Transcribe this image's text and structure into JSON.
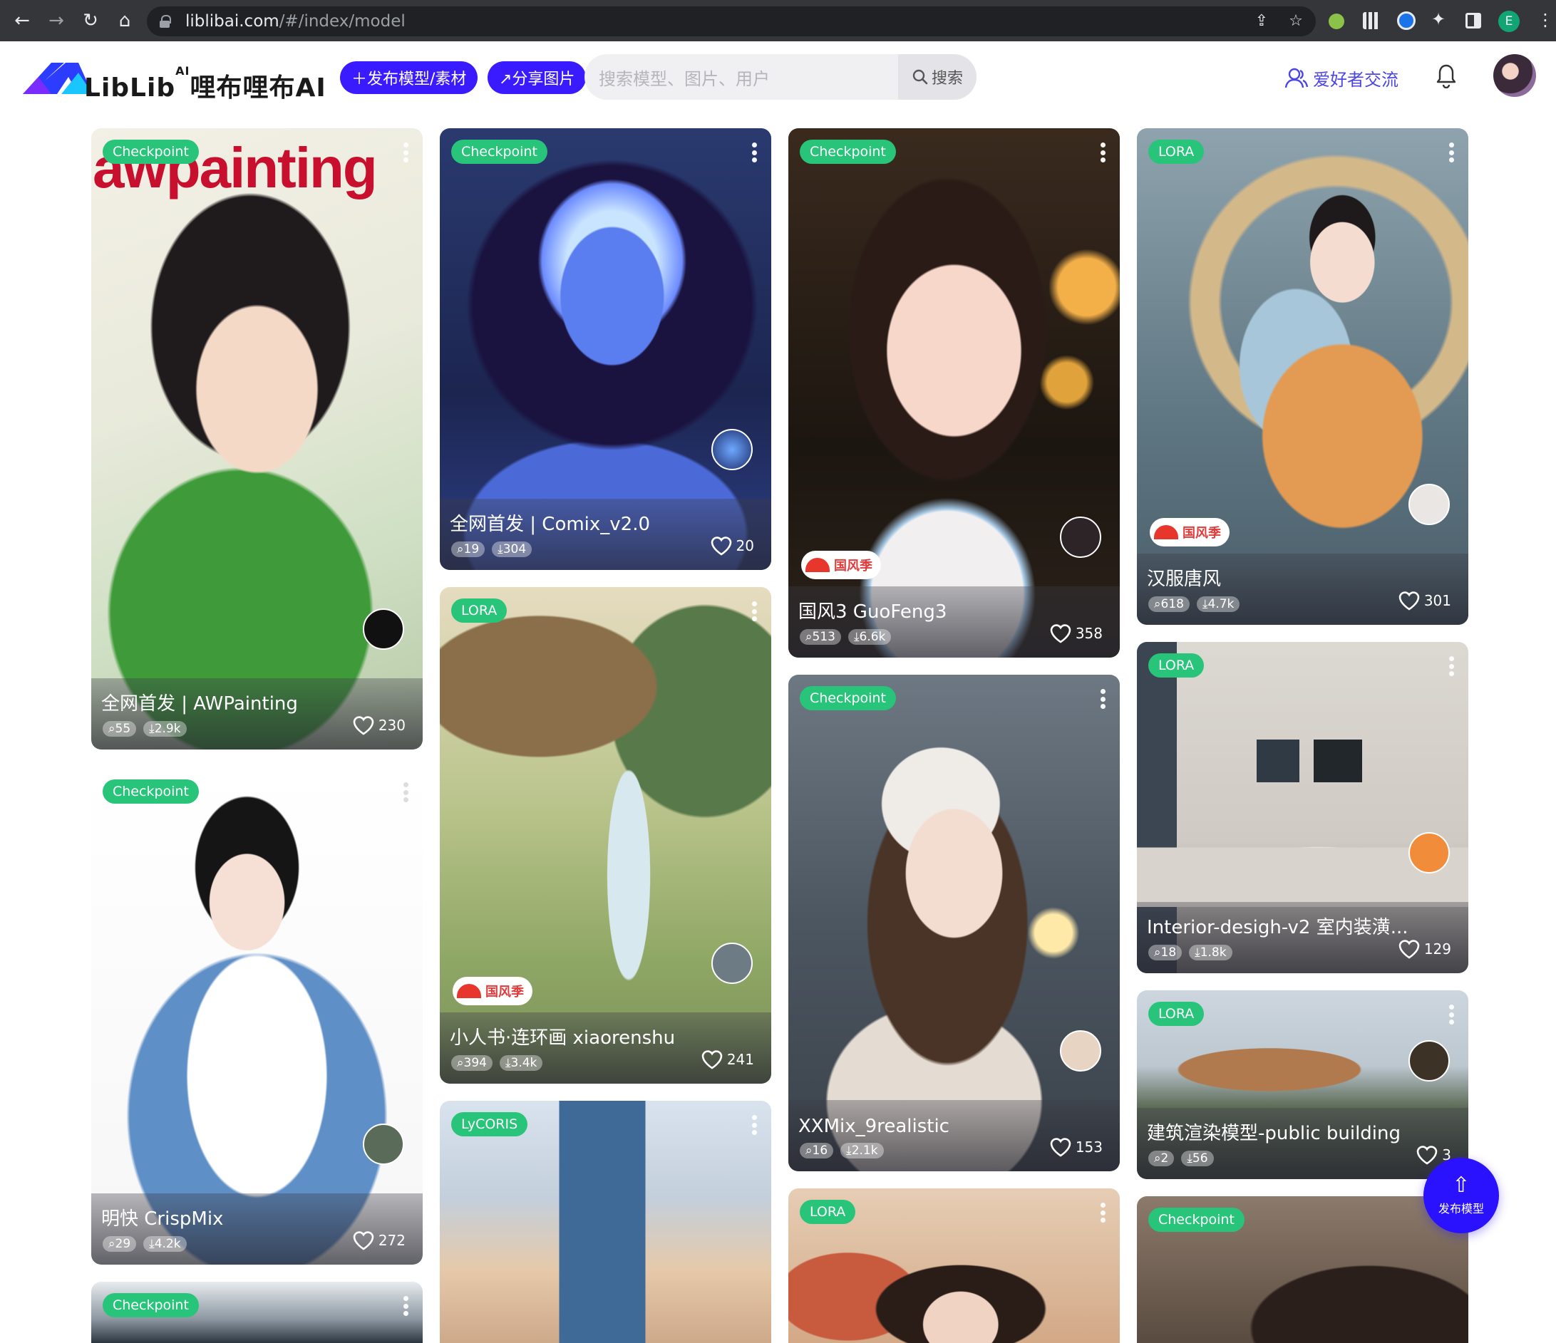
{
  "browser": {
    "url_host": "liblibai.com",
    "url_path": "/#/index/model",
    "profile_initial": "E"
  },
  "header": {
    "logo_text": "LibLib",
    "logo_sup": "AI",
    "logo_cn": "哩布哩布AI",
    "publish_button": "＋发布模型/素材",
    "share_button": "↗分享图片",
    "search_placeholder": "搜索模型、图片、用户",
    "search_button": "搜索",
    "community_link": "爱好者交流"
  },
  "cards": [
    {
      "badge": "Checkpoint",
      "title": "全网首发 | AWPainting",
      "comments": "55",
      "downloads": "2.9k",
      "likes": "230",
      "banner": "awpainting"
    },
    {
      "badge": "Checkpoint",
      "title": "全网首发 | Comix_v2.0",
      "comments": "19",
      "downloads": "304",
      "likes": "20"
    },
    {
      "badge": "Checkpoint",
      "title": "国风3 GuoFeng3",
      "comments": "513",
      "downloads": "6.6k",
      "likes": "358",
      "tag": "国风季"
    },
    {
      "badge": "LORA",
      "title": "汉服唐风",
      "comments": "618",
      "downloads": "4.7k",
      "likes": "301",
      "tag": "国风季"
    },
    {
      "badge": "Checkpoint",
      "title": "明快 CrispMix",
      "comments": "29",
      "downloads": "4.2k",
      "likes": "272"
    },
    {
      "badge": "LORA",
      "title": "小人书·连环画 xiaorenshu",
      "comments": "394",
      "downloads": "3.4k",
      "likes": "241",
      "tag": "国风季"
    },
    {
      "badge": "Checkpoint",
      "title": "XXMix_9realistic",
      "comments": "16",
      "downloads": "2.1k",
      "likes": "153"
    },
    {
      "badge": "LORA",
      "title": "Interior-desigh-v2 室内装潢...",
      "comments": "18",
      "downloads": "1.8k",
      "likes": "129"
    },
    {
      "badge": "LORA",
      "title": "建筑渲染模型-public building",
      "comments": "2",
      "downloads": "56",
      "likes": "3"
    },
    {
      "badge": "Checkpoint"
    },
    {
      "badge": "LyCORIS"
    },
    {
      "badge": "LORA"
    },
    {
      "badge": "Checkpoint"
    }
  ],
  "fab": {
    "label": "发布模型"
  },
  "colors": {
    "brand": "#3a1bff",
    "badge_green": "#27c47a",
    "chrome_bg": "#35363a"
  }
}
